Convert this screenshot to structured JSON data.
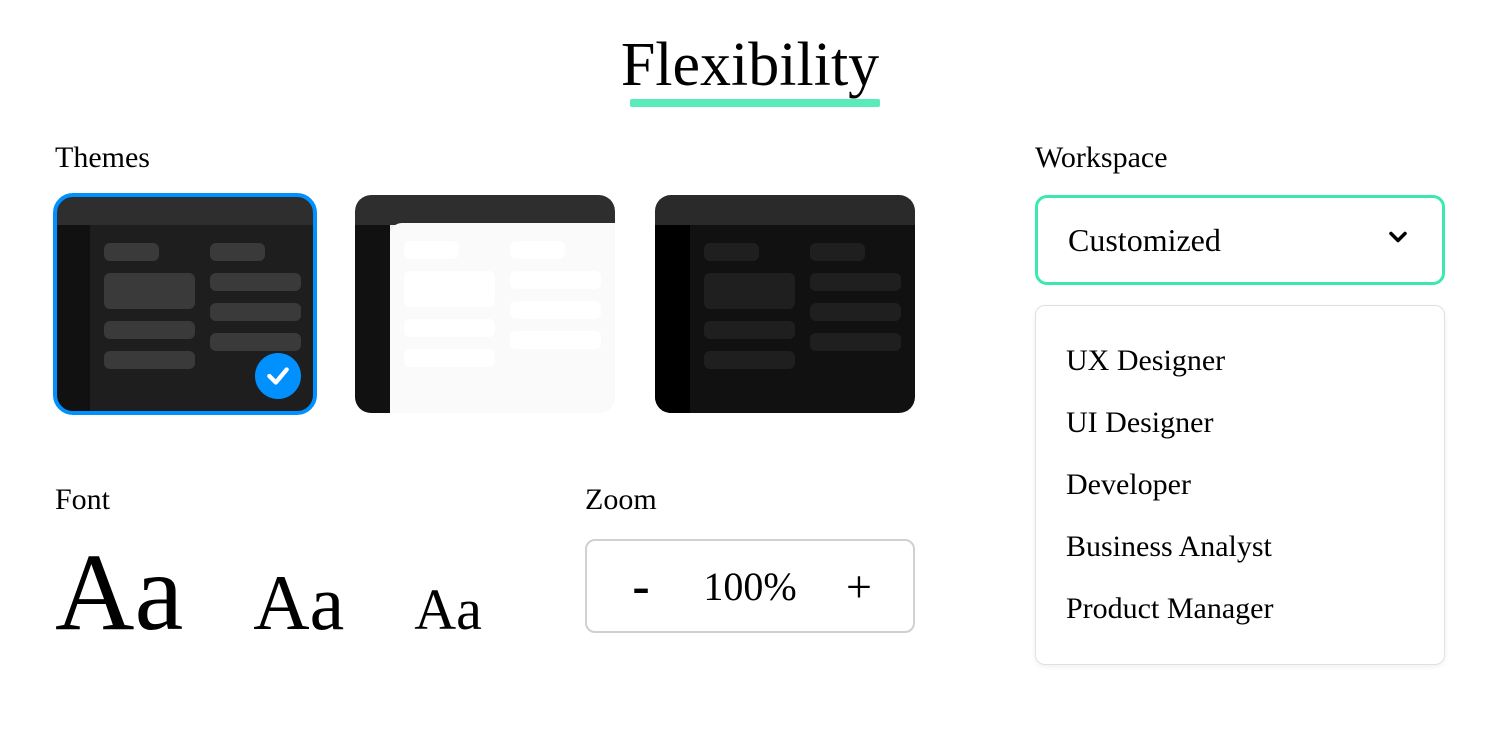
{
  "title": "Flexibility",
  "themes": {
    "label": "Themes",
    "selected_index": 0,
    "items": [
      {
        "id": "dark",
        "selected": true
      },
      {
        "id": "light",
        "selected": false
      },
      {
        "id": "black",
        "selected": false
      }
    ]
  },
  "font": {
    "label": "Font",
    "samples": [
      "Aa",
      "Aa",
      "Aa"
    ]
  },
  "zoom": {
    "label": "Zoom",
    "minus": "-",
    "value": "100%",
    "plus": "+"
  },
  "workspace": {
    "label": "Workspace",
    "selected": "Customized",
    "options": [
      "UX Designer",
      "UI Designer",
      "Developer",
      "Business Analyst",
      "Product Manager"
    ]
  }
}
